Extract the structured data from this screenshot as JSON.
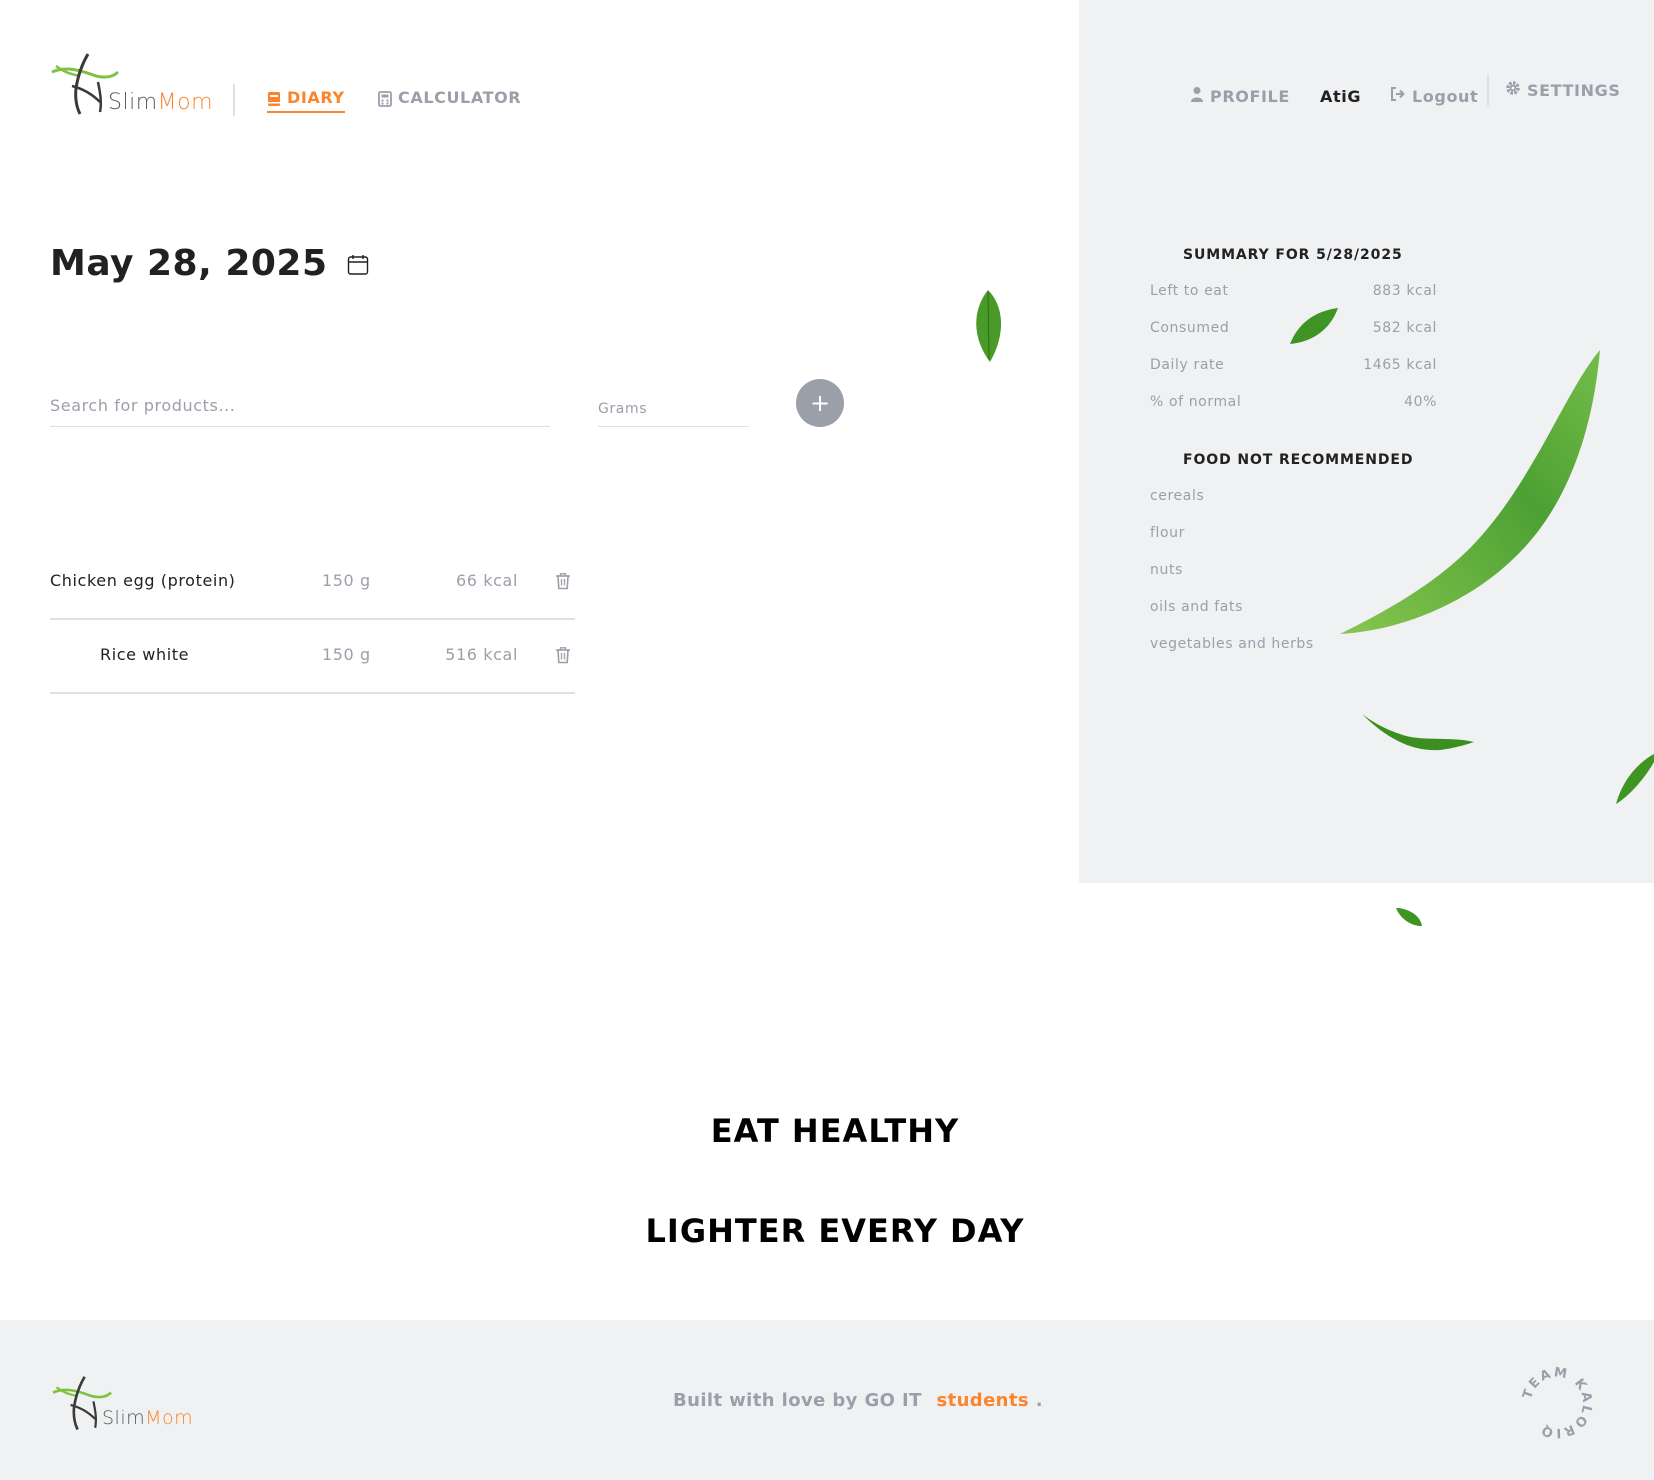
{
  "brand": {
    "slim": "Slim",
    "mom": "Mom",
    "accent_color": "#fc842d",
    "muted_color": "#9b9faa"
  },
  "nav": {
    "diary": {
      "label": "DIARY",
      "icon": "book-icon",
      "active": true
    },
    "calculator": {
      "label": "CALCULATOR",
      "icon": "calculator-icon",
      "active": false
    }
  },
  "user_menu": {
    "profile_label": "PROFILE",
    "username": "AtiG",
    "logout_label": "Logout",
    "settings_label": "SETTINGS"
  },
  "diary": {
    "date": "May 28, 2025",
    "search_placeholder": "Search for products...",
    "grams_placeholder": "Grams",
    "add_label": "+"
  },
  "products": [
    {
      "name": "Chicken egg (protein)",
      "grams": "150 g",
      "kcal": "66 kcal"
    },
    {
      "name": "Rice white",
      "grams": "150 g",
      "kcal": "516 kcal"
    }
  ],
  "summary": {
    "title": "SUMMARY FOR 5/28/2025",
    "rows": [
      {
        "label": "Left to eat",
        "value": "883 kcal"
      },
      {
        "label": "Consumed",
        "value": "582 kcal"
      },
      {
        "label": "Daily rate",
        "value": "1465 kcal"
      },
      {
        "label": "% of normal",
        "value": "40%"
      }
    ]
  },
  "not_recommended": {
    "title": "FOOD NOT RECOMMENDED",
    "items": [
      "cereals",
      "flour",
      "nuts",
      "oils and fats",
      "vegetables and herbs"
    ]
  },
  "slogan": {
    "line1": "EAT HEALTHY",
    "line2": "LIGHTER EVERY DAY"
  },
  "footer": {
    "text": "Built with love by GO IT",
    "link": "students",
    "period": ".",
    "team_badge": "TEAM KALORIQ"
  }
}
